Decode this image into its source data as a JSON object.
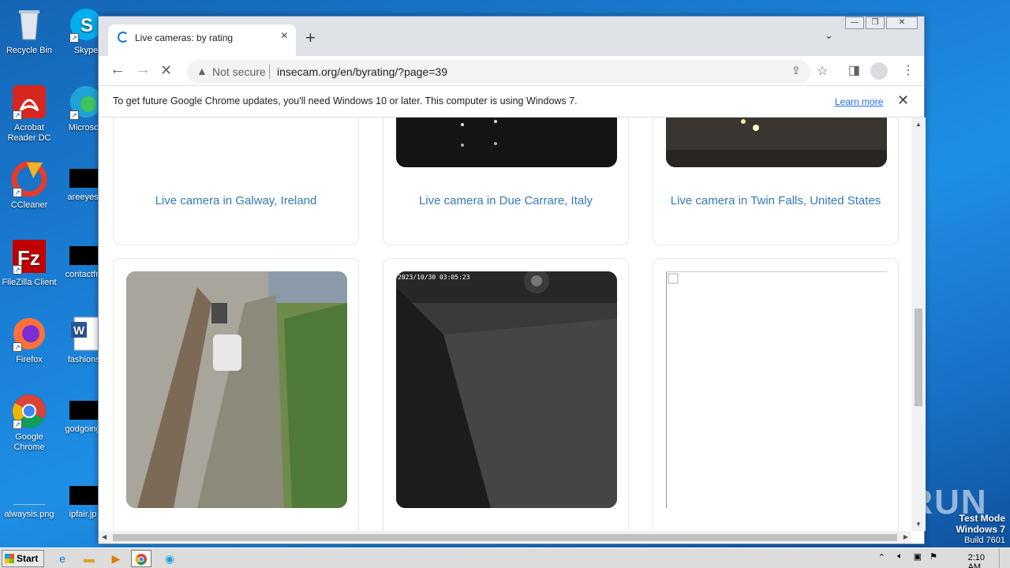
{
  "desktop": {
    "icons": [
      {
        "label": "Recycle Bin"
      },
      {
        "label": "Skype"
      },
      {
        "label": "Acrobat Reader DC"
      },
      {
        "label": "Microsoft"
      },
      {
        "label": "CCleaner"
      },
      {
        "label": "areeyes"
      },
      {
        "label": "FileZilla Client"
      },
      {
        "label": "contactfri"
      },
      {
        "label": "Firefox"
      },
      {
        "label": "fashionsy"
      },
      {
        "label": "Google Chrome"
      },
      {
        "label": "godgoing"
      },
      {
        "label": "alwaysis.png"
      },
      {
        "label": "ipfair.jp"
      }
    ],
    "watermark": {
      "line1": "Test Mode",
      "line2": "Windows 7",
      "line3": "Build 7601"
    },
    "brand": "ANY RUN"
  },
  "browser": {
    "tab_title": "Live cameras: by rating",
    "new_tab_symbol": "+",
    "url_warning": "Not secure",
    "url": "insecam.org/en/byrating/?page=39",
    "infobar_message": "To get future Google Chrome updates, you'll need Windows 10 or later. This computer is using Windows 7.",
    "infobar_link": "Learn more"
  },
  "page": {
    "cameras_row1": [
      {
        "link": "Live camera in Galway, Ireland"
      },
      {
        "link": "Live camera in Due Carrare, Italy"
      },
      {
        "link": "Live camera in Twin Falls, United States"
      }
    ],
    "cam2_timestamp": "2023/10/30 03:05:23"
  },
  "taskbar": {
    "start_label": "Start",
    "clock": "2:10 AM"
  },
  "colors": {
    "link": "#337ab7",
    "chrome_accent": "#1a73e8"
  }
}
